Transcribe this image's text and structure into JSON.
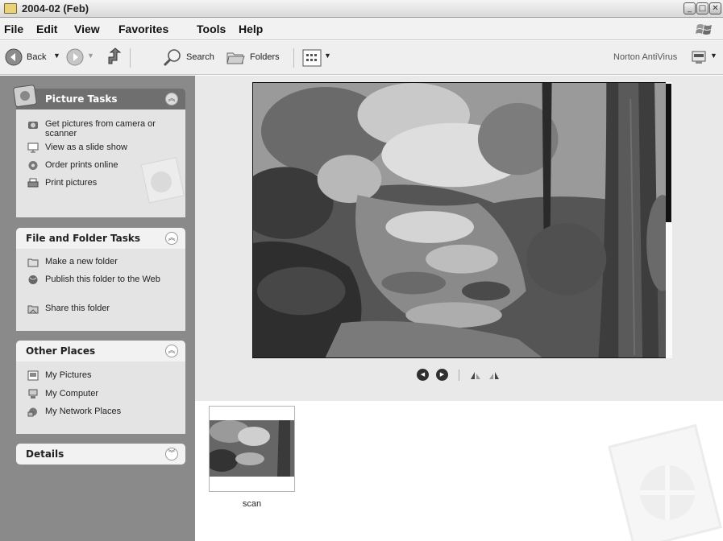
{
  "window": {
    "title": "2004-02 (Feb)",
    "controls": [
      "minimize",
      "maximize",
      "close"
    ]
  },
  "menu": [
    "File",
    "Edit",
    "View",
    "Favorites",
    "Tools",
    "Help"
  ],
  "toolbar": {
    "back_label": "Back",
    "search_label": "Search",
    "folders_label": "Folders",
    "antivirus_label": "Norton AntiVirus",
    "icons": [
      "back-arrow-icon",
      "forward-arrow-icon",
      "up-folder-icon",
      "search-icon",
      "folders-icon",
      "views-icon",
      "antivirus-icon"
    ]
  },
  "left_pane": {
    "picture_tasks": {
      "title": "Picture Tasks",
      "items": [
        {
          "label": "Get pictures from camera or scanner",
          "icon": "camera-icon"
        },
        {
          "label": "View as a slide show",
          "icon": "slideshow-icon"
        },
        {
          "label": "Order prints online",
          "icon": "order-prints-icon"
        },
        {
          "label": "Print pictures",
          "icon": "printer-icon"
        }
      ]
    },
    "file_folder_tasks": {
      "title": "File and Folder Tasks",
      "items": [
        {
          "label": "Make a new folder",
          "icon": "new-folder-icon"
        },
        {
          "label": "Publish this folder to the Web",
          "icon": "publish-web-icon"
        },
        {
          "label": "Share this folder",
          "icon": "share-folder-icon"
        }
      ]
    },
    "other_places": {
      "title": "Other Places",
      "items": [
        {
          "label": "My Pictures",
          "icon": "my-pictures-icon"
        },
        {
          "label": "My Computer",
          "icon": "my-computer-icon"
        },
        {
          "label": "My Network Places",
          "icon": "network-places-icon"
        }
      ]
    },
    "details": {
      "title": "Details"
    }
  },
  "preview": {
    "controls": [
      "previous-image-icon",
      "next-image-icon",
      "rotate-clockwise-icon",
      "rotate-counterclockwise-icon"
    ]
  },
  "filmstrip": {
    "items": [
      {
        "label": "scan"
      }
    ]
  },
  "colors": {
    "left_pane_bg": "#8a8a8a",
    "panel_body_bg": "#e4e4e4",
    "special_header_bg": "#6f6f6f",
    "normal_header_bg": "#f2f2f2",
    "preview_bg": "#e9e9e9"
  }
}
